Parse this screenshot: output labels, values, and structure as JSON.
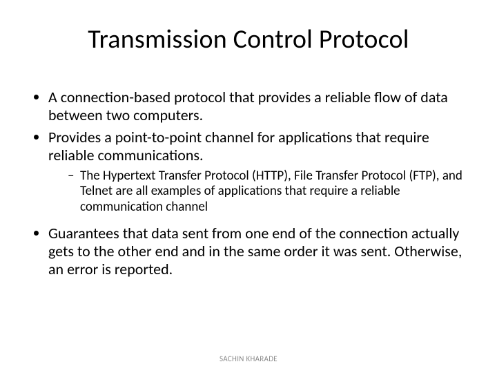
{
  "title": "Transmission Control Protocol",
  "bullets": {
    "b1": "A connection-based protocol that provides a reliable flow of data between two computers.",
    "b2": "Provides a point-to-point channel for applications that require reliable communications.",
    "b2_sub1": "The Hypertext Transfer Protocol (HTTP), File Transfer Protocol (FTP), and Telnet are all examples of applications that require a reliable communication channel",
    "b3": "Guarantees that data sent from one end of the connection actually gets to the other end and in the same order it was sent. Otherwise, an error is reported."
  },
  "footer": "SACHIN KHARADE"
}
